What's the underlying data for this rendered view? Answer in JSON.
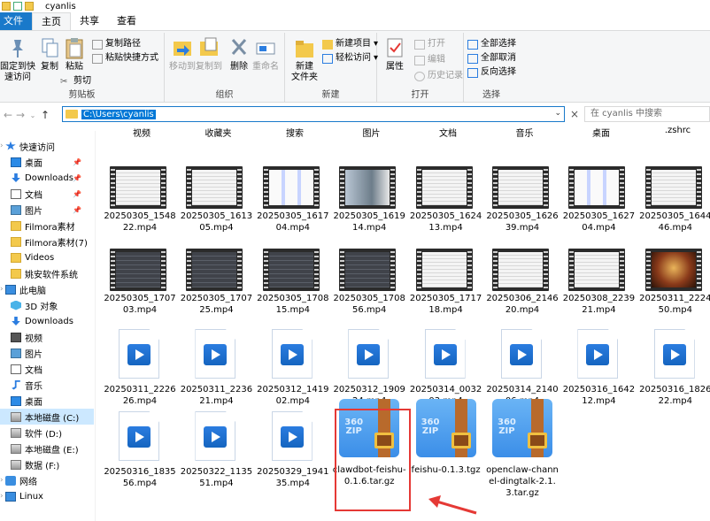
{
  "window": {
    "title": "cyanlis"
  },
  "tabs": [
    "文件",
    "主页",
    "共享",
    "查看"
  ],
  "ribbon": {
    "clipboard": {
      "label": "剪贴板",
      "pin": "固定到快\n速访问",
      "copy": "复制",
      "paste": "粘贴",
      "copy_path": "复制路径",
      "paste_shortcut": "粘贴快捷方式",
      "cut": "剪切"
    },
    "organize": {
      "label": "组织",
      "move_to": "移动到",
      "copy_to": "复制到",
      "delete": "删除",
      "rename": "重命名"
    },
    "new": {
      "label": "新建",
      "new_folder": "新建\n文件夹",
      "new_item": "新建项目",
      "easy_access": "轻松访问"
    },
    "open": {
      "label": "打开",
      "properties": "属性",
      "open": "打开",
      "edit": "编辑",
      "history": "历史记录"
    },
    "select": {
      "label": "选择",
      "select_all": "全部选择",
      "select_none": "全部取消",
      "invert": "反向选择"
    }
  },
  "address": {
    "path": "C:\\Users\\cyanlis",
    "search_placeholder": "在 cyanlis 中搜索"
  },
  "nav": {
    "items": [
      {
        "label": "快速访问",
        "kind": "star",
        "indent": 0
      },
      {
        "label": "桌面",
        "kind": "desk",
        "indent": 1,
        "pin": true
      },
      {
        "label": "Downloads",
        "kind": "down",
        "indent": 1,
        "pin": true
      },
      {
        "label": "文档",
        "kind": "doc",
        "indent": 1,
        "pin": true
      },
      {
        "label": "图片",
        "kind": "pic",
        "indent": 1,
        "pin": true
      },
      {
        "label": "Filmora素材",
        "kind": "fold",
        "indent": 1
      },
      {
        "label": "Filmora素材(7)",
        "kind": "fold",
        "indent": 1
      },
      {
        "label": "Videos",
        "kind": "fold",
        "indent": 1
      },
      {
        "label": "姚安软件系统",
        "kind": "fold",
        "indent": 1
      },
      {
        "label": "此电脑",
        "kind": "pc",
        "indent": 0
      },
      {
        "label": "3D 对象",
        "kind": "3d",
        "indent": 1
      },
      {
        "label": "Downloads",
        "kind": "down",
        "indent": 1
      },
      {
        "label": "视频",
        "kind": "vid",
        "indent": 1
      },
      {
        "label": "图片",
        "kind": "pic",
        "indent": 1
      },
      {
        "label": "文档",
        "kind": "doc",
        "indent": 1
      },
      {
        "label": "音乐",
        "kind": "music",
        "indent": 1
      },
      {
        "label": "桌面",
        "kind": "desk",
        "indent": 1
      },
      {
        "label": "本地磁盘 (C:)",
        "kind": "drive",
        "indent": 1,
        "selected": true
      },
      {
        "label": "软件 (D:)",
        "kind": "drive",
        "indent": 1
      },
      {
        "label": "本地磁盘 (E:)",
        "kind": "drive",
        "indent": 1
      },
      {
        "label": "数据 (F:)",
        "kind": "drive",
        "indent": 1
      },
      {
        "label": "网络",
        "kind": "net",
        "indent": 0
      },
      {
        "label": "Linux",
        "kind": "pc",
        "indent": 0
      }
    ]
  },
  "folders": [
    "视频",
    "收藏夹",
    "搜索",
    "图片",
    "文档",
    "音乐",
    "桌面",
    ".zshrc"
  ],
  "files": [
    {
      "name": "20250305_154822.mp4",
      "type": "thumb",
      "variant": "light"
    },
    {
      "name": "20250305_161305.mp4",
      "type": "thumb",
      "variant": "light"
    },
    {
      "name": "20250305_161704.mp4",
      "type": "thumb",
      "variant": "diagram"
    },
    {
      "name": "20250305_161914.mp4",
      "type": "thumb",
      "variant": "photo"
    },
    {
      "name": "20250305_162413.mp4",
      "type": "thumb",
      "variant": "light"
    },
    {
      "name": "20250305_162639.mp4",
      "type": "thumb",
      "variant": "light"
    },
    {
      "name": "20250305_162704.mp4",
      "type": "thumb",
      "variant": "diagram"
    },
    {
      "name": "20250305_164446.mp4",
      "type": "thumb",
      "variant": "light"
    },
    {
      "name": "20250305_170703.mp4",
      "type": "thumb",
      "variant": "dark"
    },
    {
      "name": "20250305_170725.mp4",
      "type": "thumb",
      "variant": "dark"
    },
    {
      "name": "20250305_170815.mp4",
      "type": "thumb",
      "variant": "dark"
    },
    {
      "name": "20250305_170856.mp4",
      "type": "thumb",
      "variant": "dark"
    },
    {
      "name": "20250305_171718.mp4",
      "type": "thumb",
      "variant": "light"
    },
    {
      "name": "20250306_214620.mp4",
      "type": "thumb",
      "variant": "light"
    },
    {
      "name": "20250308_223921.mp4",
      "type": "thumb",
      "variant": "light"
    },
    {
      "name": "20250311_222450.mp4",
      "type": "thumb",
      "variant": "poster"
    },
    {
      "name": "20250311_222626.mp4",
      "type": "video"
    },
    {
      "name": "20250311_223621.mp4",
      "type": "video"
    },
    {
      "name": "20250312_141902.mp4",
      "type": "video"
    },
    {
      "name": "20250312_190924.mp4",
      "type": "video"
    },
    {
      "name": "20250314_003203.mp4",
      "type": "video"
    },
    {
      "name": "20250314_214006.mp4",
      "type": "video"
    },
    {
      "name": "20250316_164212.mp4",
      "type": "video"
    },
    {
      "name": "20250316_182622.mp4",
      "type": "video"
    },
    {
      "name": "20250316_183556.mp4",
      "type": "video"
    },
    {
      "name": "20250322_113551.mp4",
      "type": "video"
    },
    {
      "name": "20250329_194135.mp4",
      "type": "video"
    },
    {
      "name": "clawdbot-feishu-0.1.6.tar.gz",
      "type": "zip",
      "label": "360\nZIP"
    },
    {
      "name": "feishu-0.1.3.tgz",
      "type": "zip",
      "label": "360\nZIP"
    },
    {
      "name": "openclaw-channel-dingtalk-2.1.3.tar.gz",
      "type": "zip",
      "label": "360\nZIP"
    }
  ],
  "colors": {
    "accent": "#1979ca",
    "selection": "#cce8ff",
    "highlight_box": "#e53935"
  }
}
